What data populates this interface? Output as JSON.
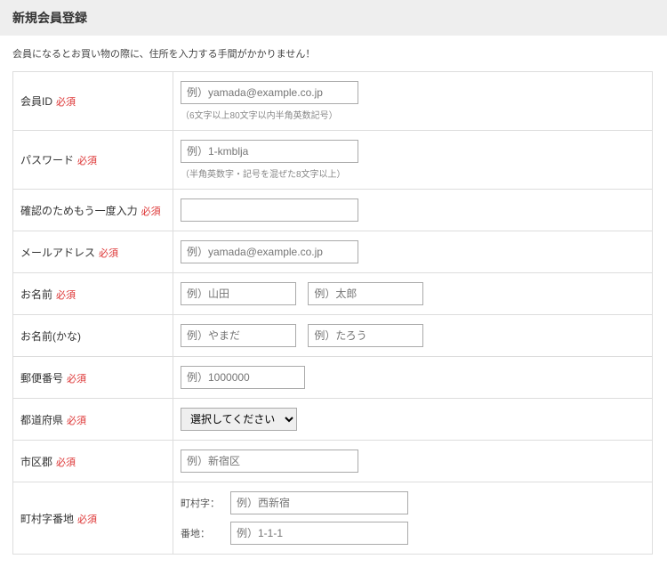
{
  "header": {
    "title": "新規会員登録"
  },
  "intro": "会員になるとお買い物の際に、住所を入力する手間がかかりません！",
  "required_tag": "必須",
  "labels": {
    "member_id": "会員ID",
    "password": "パスワード",
    "password_confirm": "確認のためもう一度入力",
    "email": "メールアドレス",
    "name": "お名前",
    "name_kana": "お名前(かな)",
    "postal": "郵便番号",
    "prefecture": "都道府県",
    "city": "市区郡",
    "town_street": "町村字番地"
  },
  "placeholders": {
    "member_id": "例）yamada@example.co.jp",
    "password": "例）1-kmblja",
    "email": "例）yamada@example.co.jp",
    "name_last": "例）山田",
    "name_first": "例）太郎",
    "kana_last": "例）やまだ",
    "kana_first": "例）たろう",
    "postal": "例）1000000",
    "city": "例）新宿区",
    "town": "例）西新宿",
    "street": "例）1-1-1"
  },
  "hints": {
    "member_id": "（6文字以上80文字以内半角英数記号）",
    "password": "（半角英数字・記号を混ぜた8文字以上）"
  },
  "prefecture_default": "選択してください",
  "sublabels": {
    "town": "町村字：",
    "street": "番地："
  }
}
